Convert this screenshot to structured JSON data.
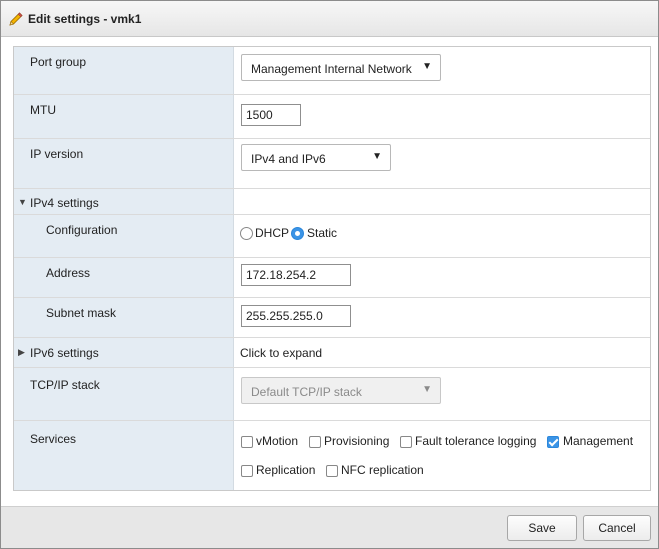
{
  "dialog": {
    "title": "Edit settings - vmk1",
    "title_icon": "pencil-icon"
  },
  "form": {
    "port_group": {
      "label": "Port group",
      "value": "Management Internal Network"
    },
    "mtu": {
      "label": "MTU",
      "value": "1500"
    },
    "ip_version": {
      "label": "IP version",
      "value": "IPv4 and IPv6"
    },
    "ipv4": {
      "label": "IPv4 settings",
      "expanded": true,
      "configuration": {
        "label": "Configuration",
        "options": [
          {
            "label": "DHCP",
            "checked": false
          },
          {
            "label": "Static",
            "checked": true
          }
        ]
      },
      "address": {
        "label": "Address",
        "value": "172.18.254.2"
      },
      "subnet_mask": {
        "label": "Subnet mask",
        "value": "255.255.255.0"
      }
    },
    "ipv6": {
      "label": "IPv6 settings",
      "expanded": false,
      "hint": "Click to expand"
    },
    "tcpip_stack": {
      "label": "TCP/IP stack",
      "value": "Default TCP/IP stack",
      "disabled": true
    },
    "services": {
      "label": "Services",
      "items": [
        {
          "label": "vMotion",
          "checked": false
        },
        {
          "label": "Provisioning",
          "checked": false
        },
        {
          "label": "Fault tolerance logging",
          "checked": false
        },
        {
          "label": "Management",
          "checked": true
        },
        {
          "label": "Replication",
          "checked": false
        },
        {
          "label": "NFC replication",
          "checked": false
        }
      ]
    }
  },
  "footer": {
    "save_label": "Save",
    "cancel_label": "Cancel"
  },
  "colors": {
    "label_column_bg": "#e4ecf3",
    "accent": "#3b94e6",
    "footer_bg": "#e7e7e7"
  }
}
